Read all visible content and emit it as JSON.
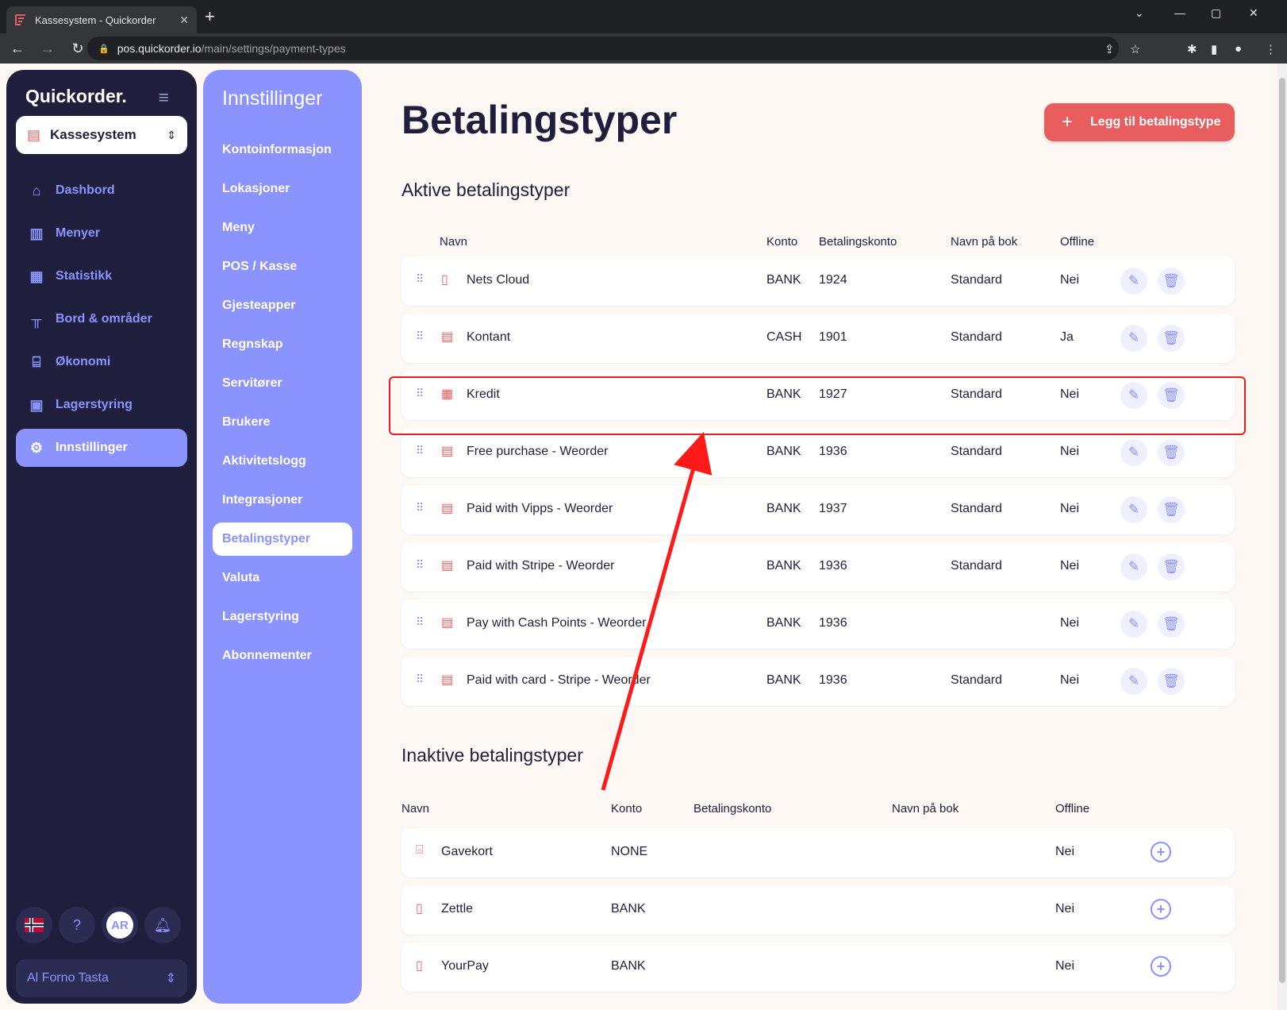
{
  "browser": {
    "tab_title": "Kassesystem - Quickorder",
    "tab_close": "✕",
    "new_tab": "+",
    "url_host": "pos.quickorder.io",
    "url_path": "/main/settings/payment-types"
  },
  "sidebar": {
    "logo": "Quickorder.",
    "system_selector": "Kassesystem",
    "items": [
      {
        "label": "Dashbord",
        "icon": "home-icon"
      },
      {
        "label": "Menyer",
        "icon": "book-icon"
      },
      {
        "label": "Statistikk",
        "icon": "chart-icon"
      },
      {
        "label": "Bord & områder",
        "icon": "table-icon"
      },
      {
        "label": "Økonomi",
        "icon": "bank-icon"
      },
      {
        "label": "Lagerstyring",
        "icon": "archive-icon"
      },
      {
        "label": "Innstillinger",
        "icon": "gear-icon",
        "active": true
      }
    ],
    "avatar_initials": "AR",
    "location": "Al Forno Tasta"
  },
  "settings_nav": {
    "title": "Innstillinger",
    "items": [
      "Kontoinformasjon",
      "Lokasjoner",
      "Meny",
      "POS / Kasse",
      "Gjesteapper",
      "Regnskap",
      "Servitører",
      "Brukere",
      "Aktivitetslogg",
      "Integrasjoner",
      "Betalingstyper",
      "Valuta",
      "Lagerstyring",
      "Abonnementer"
    ],
    "active": "Betalingstyper"
  },
  "page": {
    "title": "Betalingstyper",
    "add_button": "Legg til betalingstype",
    "active_section": "Aktive betalingstyper",
    "inactive_section": "Inaktive betalingstyper",
    "headers": {
      "name": "Navn",
      "konto": "Konto",
      "betalingskonto": "Betalingskonto",
      "bok": "Navn på bok",
      "offline": "Offline"
    }
  },
  "active_types": [
    {
      "name": "Nets Cloud",
      "konto": "BANK",
      "betalingskonto": "1924",
      "bok": "Standard",
      "offline": "Nei",
      "icon": "terminal-icon"
    },
    {
      "name": "Kontant",
      "konto": "CASH",
      "betalingskonto": "1901",
      "bok": "Standard",
      "offline": "Ja",
      "icon": "cash-icon"
    },
    {
      "name": "Kredit",
      "konto": "BANK",
      "betalingskonto": "1927",
      "bok": "Standard",
      "offline": "Nei",
      "icon": "invoice-icon"
    },
    {
      "name": "Free purchase - Weorder",
      "konto": "BANK",
      "betalingskonto": "1936",
      "bok": "Standard",
      "offline": "Nei",
      "icon": "cash-icon"
    },
    {
      "name": "Paid with Vipps - Weorder",
      "konto": "BANK",
      "betalingskonto": "1937",
      "bok": "Standard",
      "offline": "Nei",
      "icon": "cash-icon"
    },
    {
      "name": "Paid with Stripe - Weorder",
      "konto": "BANK",
      "betalingskonto": "1936",
      "bok": "Standard",
      "offline": "Nei",
      "icon": "cash-icon"
    },
    {
      "name": "Pay with Cash Points - Weorder",
      "konto": "BANK",
      "betalingskonto": "1936",
      "bok": "",
      "offline": "Nei",
      "icon": "cash-icon"
    },
    {
      "name": "Paid with card - Stripe - Weorder",
      "konto": "BANK",
      "betalingskonto": "1936",
      "bok": "Standard",
      "offline": "Nei",
      "icon": "cash-icon"
    }
  ],
  "inactive_types": [
    {
      "name": "Gavekort",
      "konto": "NONE",
      "offline": "Nei",
      "icon": "gift-icon"
    },
    {
      "name": "Zettle",
      "konto": "BANK",
      "offline": "Nei",
      "icon": "terminal-icon"
    },
    {
      "name": "YourPay",
      "konto": "BANK",
      "offline": "Nei",
      "icon": "terminal-icon"
    }
  ],
  "colors": {
    "accent": "#8b93ff",
    "danger": "#e85d5d",
    "sidebar": "#1f1f3d",
    "background": "#fdf8f3"
  }
}
